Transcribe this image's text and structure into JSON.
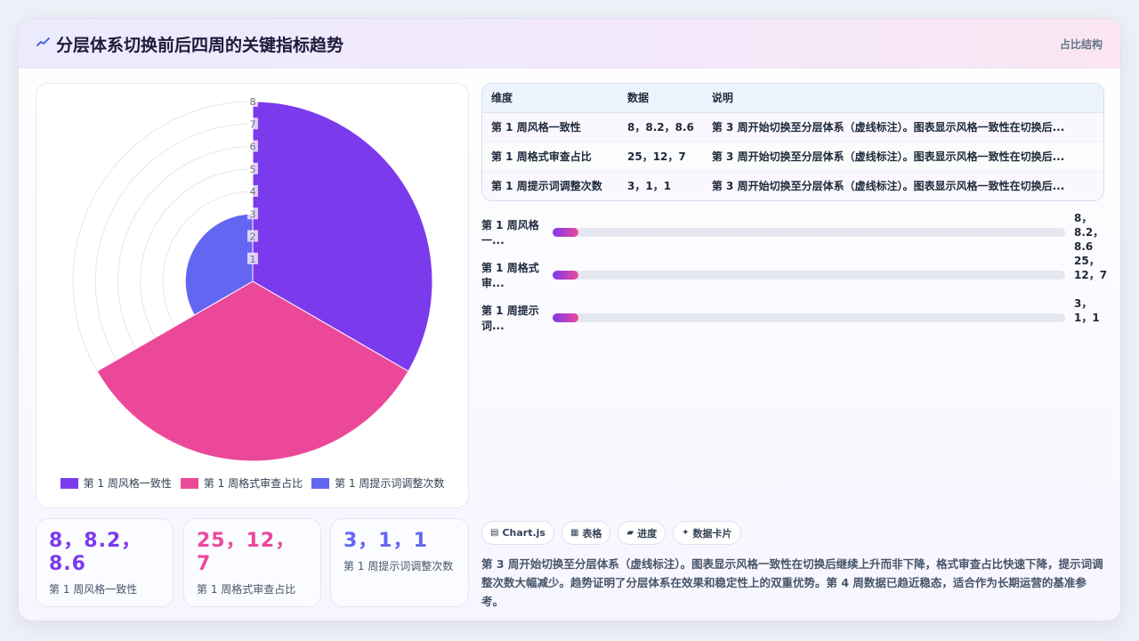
{
  "header": {
    "title": "分层体系切换前后四周的关键指标趋势",
    "tag": "占比结构",
    "icon": "chart-spark-icon"
  },
  "chart_data": {
    "type": "polarArea",
    "categories": [
      "第 1 周风格一致性",
      "第 1 周格式审查占比",
      "第 1 周提示词调整次数"
    ],
    "values": [
      8,
      25,
      3
    ],
    "r_ticks": [
      "1",
      "2",
      "3",
      "4",
      "5",
      "6",
      "7",
      "8"
    ],
    "rlim": [
      0,
      8
    ],
    "colors": [
      "#7c3aed",
      "#ec4899",
      "#6366f1"
    ],
    "legend_position": "bottom"
  },
  "kpis": [
    {
      "value": "8，8.2，8.6",
      "label": "第 1 周风格一致性",
      "color": "#7c3aed"
    },
    {
      "value": "25，12，7",
      "label": "第 1 周格式审查占比",
      "color": "#ec4899"
    },
    {
      "value": "3，1，1",
      "label": "第 1 周提示词调整次数",
      "color": "#6366f1"
    }
  ],
  "table": {
    "headers": [
      "维度",
      "数据",
      "说明"
    ],
    "rows": [
      [
        "第 1 周风格一致性",
        "8，8.2，8.6",
        "第 3 周开始切换至分层体系（虚线标注）。图表显示风格一致性在切换后..."
      ],
      [
        "第 1 周格式审查占比",
        "25，12，7",
        "第 3 周开始切换至分层体系（虚线标注）。图表显示风格一致性在切换后..."
      ],
      [
        "第 1 周提示词调整次数",
        "3，1，1",
        "第 3 周开始切换至分层体系（虚线标注）。图表显示风格一致性在切换后..."
      ]
    ]
  },
  "progress": [
    {
      "label": "第 1 周风格一...",
      "value": "8，8.2，8.6",
      "fraction": 0.05
    },
    {
      "label": "第 1 周格式审...",
      "value": "25，12，7",
      "fraction": 0.05
    },
    {
      "label": "第 1 周提示词...",
      "value": "3，1，1",
      "fraction": 0.05
    }
  ],
  "pills": [
    {
      "icon": "▤",
      "label": "Chart.js"
    },
    {
      "icon": "▦",
      "label": "表格"
    },
    {
      "icon": "▰",
      "label": "进度"
    },
    {
      "icon": "✦",
      "label": "数据卡片"
    }
  ],
  "summary": "第 3 周开始切换至分层体系（虚线标注）。图表显示风格一致性在切换后继续上升而非下降，格式审查占比快速下降，提示词调整次数大幅减少。趋势证明了分层体系在效果和稳定性上的双重优势。第 4 周数据已趋近稳态，适合作为长期运营的基准参考。"
}
